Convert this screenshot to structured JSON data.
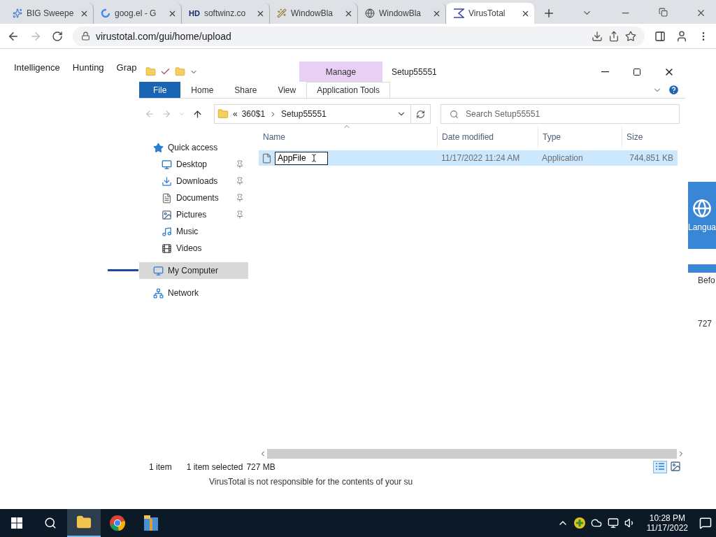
{
  "browser": {
    "tabs": [
      {
        "title": "BIG Sweepe",
        "selected": false
      },
      {
        "title": "goog.el - G",
        "selected": false
      },
      {
        "title": "softwinz.co",
        "badge": "HD",
        "selected": false
      },
      {
        "title": "WindowBla",
        "selected": false
      },
      {
        "title": "WindowBla",
        "selected": false
      },
      {
        "title": "VirusTotal",
        "selected": true
      }
    ],
    "url": "virustotal.com/gui/home/upload"
  },
  "site": {
    "nav": [
      "Intelligence",
      "Hunting",
      "Grap"
    ],
    "side_panel_label": "Langua",
    "side_heading": "Befo",
    "side_value": "727",
    "footer": "VirusTotal is not responsible for the contents of your su"
  },
  "explorer": {
    "title": "Setup55551",
    "context_group": "Manage",
    "ribbon_tabs": [
      {
        "label": "File",
        "kind": "file",
        "selected": false
      },
      {
        "label": "Home",
        "kind": "tab",
        "selected": false
      },
      {
        "label": "Share",
        "kind": "tab",
        "selected": false
      },
      {
        "label": "View",
        "kind": "tab",
        "selected": false
      },
      {
        "label": "Application Tools",
        "kind": "context",
        "selected": true
      }
    ],
    "path_overflow": "«",
    "path": [
      "360$1",
      "Setup55551"
    ],
    "search": {
      "placeholder": "Search Setup55551"
    },
    "nav": [
      {
        "label": "Quick access",
        "selected": false,
        "pinned": false,
        "children": [
          {
            "label": "Desktop",
            "selected": false,
            "pinned": true
          },
          {
            "label": "Downloads",
            "selected": false,
            "pinned": true
          },
          {
            "label": "Documents",
            "selected": false,
            "pinned": true
          },
          {
            "label": "Pictures",
            "selected": false,
            "pinned": true
          },
          {
            "label": "Music",
            "selected": false,
            "pinned": false
          },
          {
            "label": "Videos",
            "selected": false,
            "pinned": false
          }
        ]
      },
      {
        "label": "My Computer",
        "selected": true,
        "pinned": false
      },
      {
        "label": "Network",
        "selected": false,
        "pinned": false
      }
    ],
    "columns": [
      "Name",
      "Date modified",
      "Type",
      "Size"
    ],
    "files": [
      {
        "name": "AppFile",
        "date": "11/17/2022 11:24 AM",
        "type": "Application",
        "size": "744,851 KB",
        "selected": true,
        "renaming": true
      }
    ],
    "status": [
      "1 item",
      "1 item selected",
      "727 MB"
    ]
  },
  "taskbar": {
    "time": "10:28 PM",
    "date": "11/17/2022"
  }
}
